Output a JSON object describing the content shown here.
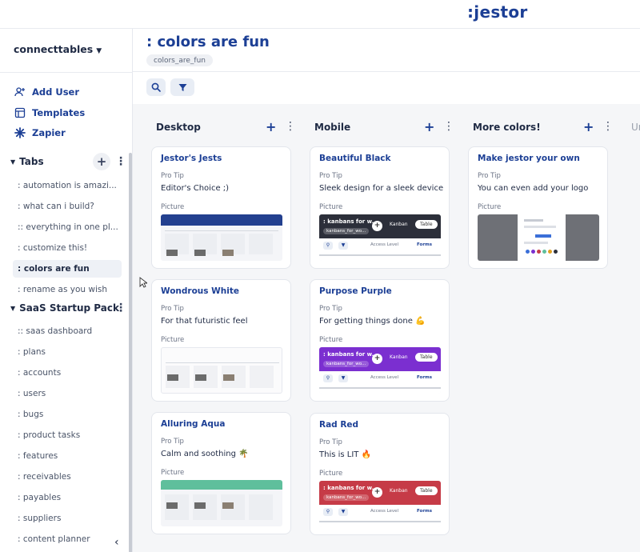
{
  "brand": {
    "logo": ":jestor"
  },
  "sidebar": {
    "workspace": "connecttables",
    "actions": [
      {
        "label": "Add User",
        "icon": "add-user-icon"
      },
      {
        "label": "Templates",
        "icon": "templates-icon"
      },
      {
        "label": "Zapier",
        "icon": "zapier-icon"
      }
    ],
    "groups": [
      {
        "label": "Tabs",
        "items": [
          ": automation is amazi...",
          ": what can i build?",
          ":: everything in one pl...",
          ": customize this!",
          ": colors are fun",
          ": rename as you wish"
        ],
        "active": ": colors are fun"
      },
      {
        "label": "SaaS Startup Pack",
        "items": [
          ":: saas dashboard",
          ": plans",
          ": accounts",
          ": users",
          ": bugs",
          ": product tasks",
          ": features",
          ": receivables",
          ": payables",
          ": suppliers",
          ": content planner"
        ]
      }
    ]
  },
  "header": {
    "title": ": colors are fun",
    "slug": "colors_are_fun"
  },
  "board": {
    "columns": [
      {
        "title": "Desktop",
        "cards": [
          {
            "title": "Jestor's Jests",
            "tip_label": "Pro Tip",
            "tip": "Editor's Choice ;)",
            "picture_label": "Picture"
          },
          {
            "title": "Wondrous White",
            "tip_label": "Pro Tip",
            "tip": "For that futuristic feel",
            "picture_label": "Picture"
          },
          {
            "title": "Alluring Aqua",
            "tip_label": "Pro Tip",
            "tip": "Calm and soothing 🌴",
            "picture_label": "Picture"
          }
        ]
      },
      {
        "title": "Mobile",
        "cards": [
          {
            "title": "Beautiful Black",
            "tip_label": "Pro Tip",
            "tip": "Sleek design for a sleek device",
            "picture_label": "Picture",
            "thumb_color": "#2c2f3a"
          },
          {
            "title": "Purpose Purple",
            "tip_label": "Pro Tip",
            "tip": "For getting things done 💪",
            "picture_label": "Picture",
            "thumb_color": "#7b2fd0"
          },
          {
            "title": "Rad Red",
            "tip_label": "Pro Tip",
            "tip": "This is LIT 🔥",
            "picture_label": "Picture",
            "thumb_color": "#c63b47"
          }
        ]
      },
      {
        "title": "More colors!",
        "cards": [
          {
            "title": "Make jestor your own",
            "tip_label": "Pro Tip",
            "tip": "You can even add your logo",
            "picture_label": "Picture"
          }
        ]
      }
    ],
    "partial_column_title": "Ur",
    "thumb": {
      "title": ": kanbans for w...",
      "slug": "kanbans_for_wo...",
      "tab_kanban": "Kanban",
      "tab_table": "Table",
      "access": "Access Level",
      "forms": "Forms"
    }
  },
  "colors": {
    "accent": "#1c3f95",
    "board_bg": "#f5f6f8",
    "aqua": "#5fbf9c",
    "navy": "#23408f"
  }
}
